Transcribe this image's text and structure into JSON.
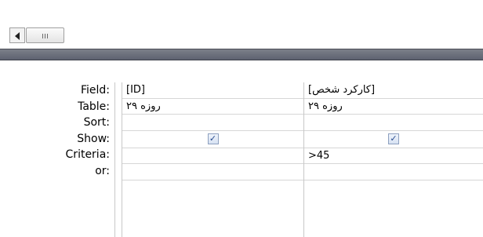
{
  "grid": {
    "row_labels": [
      "Field:",
      "Table:",
      "Sort:",
      "Show:",
      "Criteria:",
      "or:"
    ],
    "columns": [
      {
        "field": "[ID]",
        "table": "۲۹ روزه",
        "sort": "",
        "show": true,
        "show_glyph": "✓",
        "criteria": "",
        "or": ""
      },
      {
        "field": "[کارکرد شخص]",
        "table": "۲۹ روزه",
        "sort": "",
        "show": true,
        "show_glyph": "✓",
        "criteria": ">45",
        "or": ""
      }
    ]
  }
}
